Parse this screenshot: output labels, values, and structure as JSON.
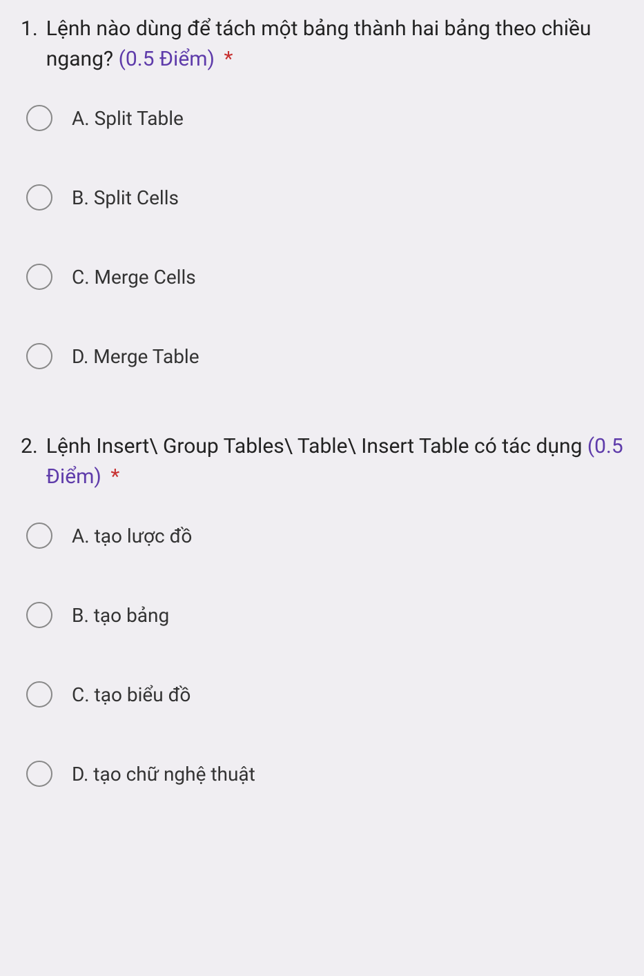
{
  "questions": [
    {
      "number": "1.",
      "text": "Lệnh nào dùng để tách một bảng thành hai bảng theo chiều ngang?",
      "points": "(0.5 Điểm)",
      "required": "*",
      "options": [
        "A. Split Table",
        "B. Split Cells",
        "C. Merge Cells",
        "D. Merge Table"
      ]
    },
    {
      "number": "2.",
      "text": "Lệnh Insert\\ Group Tables\\ Table\\ Insert Table có tác dụng",
      "points": "(0.5 Điểm)",
      "required": "*",
      "options": [
        "A. tạo lược đồ",
        "B. tạo bảng",
        "C. tạo biểu đồ",
        "D. tạo chữ nghệ thuật"
      ]
    }
  ]
}
